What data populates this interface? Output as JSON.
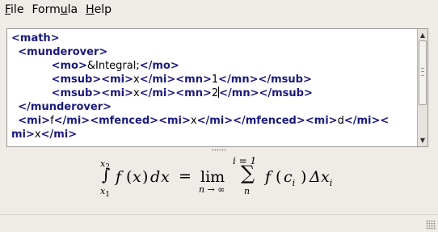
{
  "menubar": {
    "items": [
      {
        "accel": "F",
        "rest": "ile"
      },
      {
        "accel": "",
        "rest": "Form",
        "accel2": "u",
        "rest2": "la"
      },
      {
        "accel": "H",
        "rest": "elp"
      }
    ]
  },
  "editor": {
    "lines": [
      {
        "indent": "",
        "parts": [
          [
            "t",
            "<math>"
          ]
        ]
      },
      {
        "indent": "  ",
        "parts": [
          [
            "t",
            "<munderover>"
          ]
        ]
      },
      {
        "indent": "            ",
        "parts": [
          [
            "t",
            "<mo>"
          ],
          [
            "x",
            "&Integral;"
          ],
          [
            "t",
            "</mo>"
          ]
        ]
      },
      {
        "indent": "            ",
        "parts": [
          [
            "t",
            "<msub>"
          ],
          [
            "t",
            "<mi>"
          ],
          [
            "x",
            "x"
          ],
          [
            "t",
            "</mi>"
          ],
          [
            "t",
            "<mn>"
          ],
          [
            "x",
            "1"
          ],
          [
            "t",
            "</mn>"
          ],
          [
            "t",
            "</msub>"
          ]
        ]
      },
      {
        "indent": "            ",
        "parts": [
          [
            "t",
            "<msub>"
          ],
          [
            "t",
            "<mi>"
          ],
          [
            "x",
            "x"
          ],
          [
            "t",
            "</mi>"
          ],
          [
            "t",
            "<mn>"
          ],
          [
            "x",
            "2"
          ],
          [
            "c",
            ""
          ],
          [
            "t",
            "</mn>"
          ],
          [
            "t",
            "</msub>"
          ]
        ]
      },
      {
        "indent": "  ",
        "parts": [
          [
            "t",
            "</munderover>"
          ]
        ]
      },
      {
        "indent": "  ",
        "parts": [
          [
            "t",
            "<mi>"
          ],
          [
            "x",
            "f"
          ],
          [
            "t",
            "</mi>"
          ],
          [
            "t",
            "<mfenced>"
          ],
          [
            "t",
            "<mi>"
          ],
          [
            "x",
            "x"
          ],
          [
            "t",
            "</mi>"
          ],
          [
            "t",
            "</mfenced>"
          ],
          [
            "t",
            "<mi>"
          ],
          [
            "x",
            "d"
          ],
          [
            "t",
            "</mi>"
          ],
          [
            "t",
            "<"
          ]
        ]
      },
      {
        "indent": "",
        "parts": [
          [
            "t",
            "mi>"
          ],
          [
            "x",
            "x"
          ],
          [
            "t",
            "</mi>"
          ]
        ]
      }
    ]
  },
  "formula": {
    "integral": "∫",
    "upper": "x",
    "upper_sub": "2",
    "lower": "x",
    "lower_sub": "1",
    "f": "f",
    "open": "(",
    "x": "x",
    "close": ")",
    "d": "d",
    "dx": "x",
    "equals": "=",
    "lim": "lim",
    "lim_under": "n → ∞",
    "sum": "∑",
    "sum_over": "i = 1",
    "sum_under": "n",
    "f2": "f",
    "open2": "(",
    "c": "c",
    "c_sub": "i",
    "close2": ")",
    "delta": "Δ",
    "x2": "x",
    "x2_sub": "i"
  }
}
